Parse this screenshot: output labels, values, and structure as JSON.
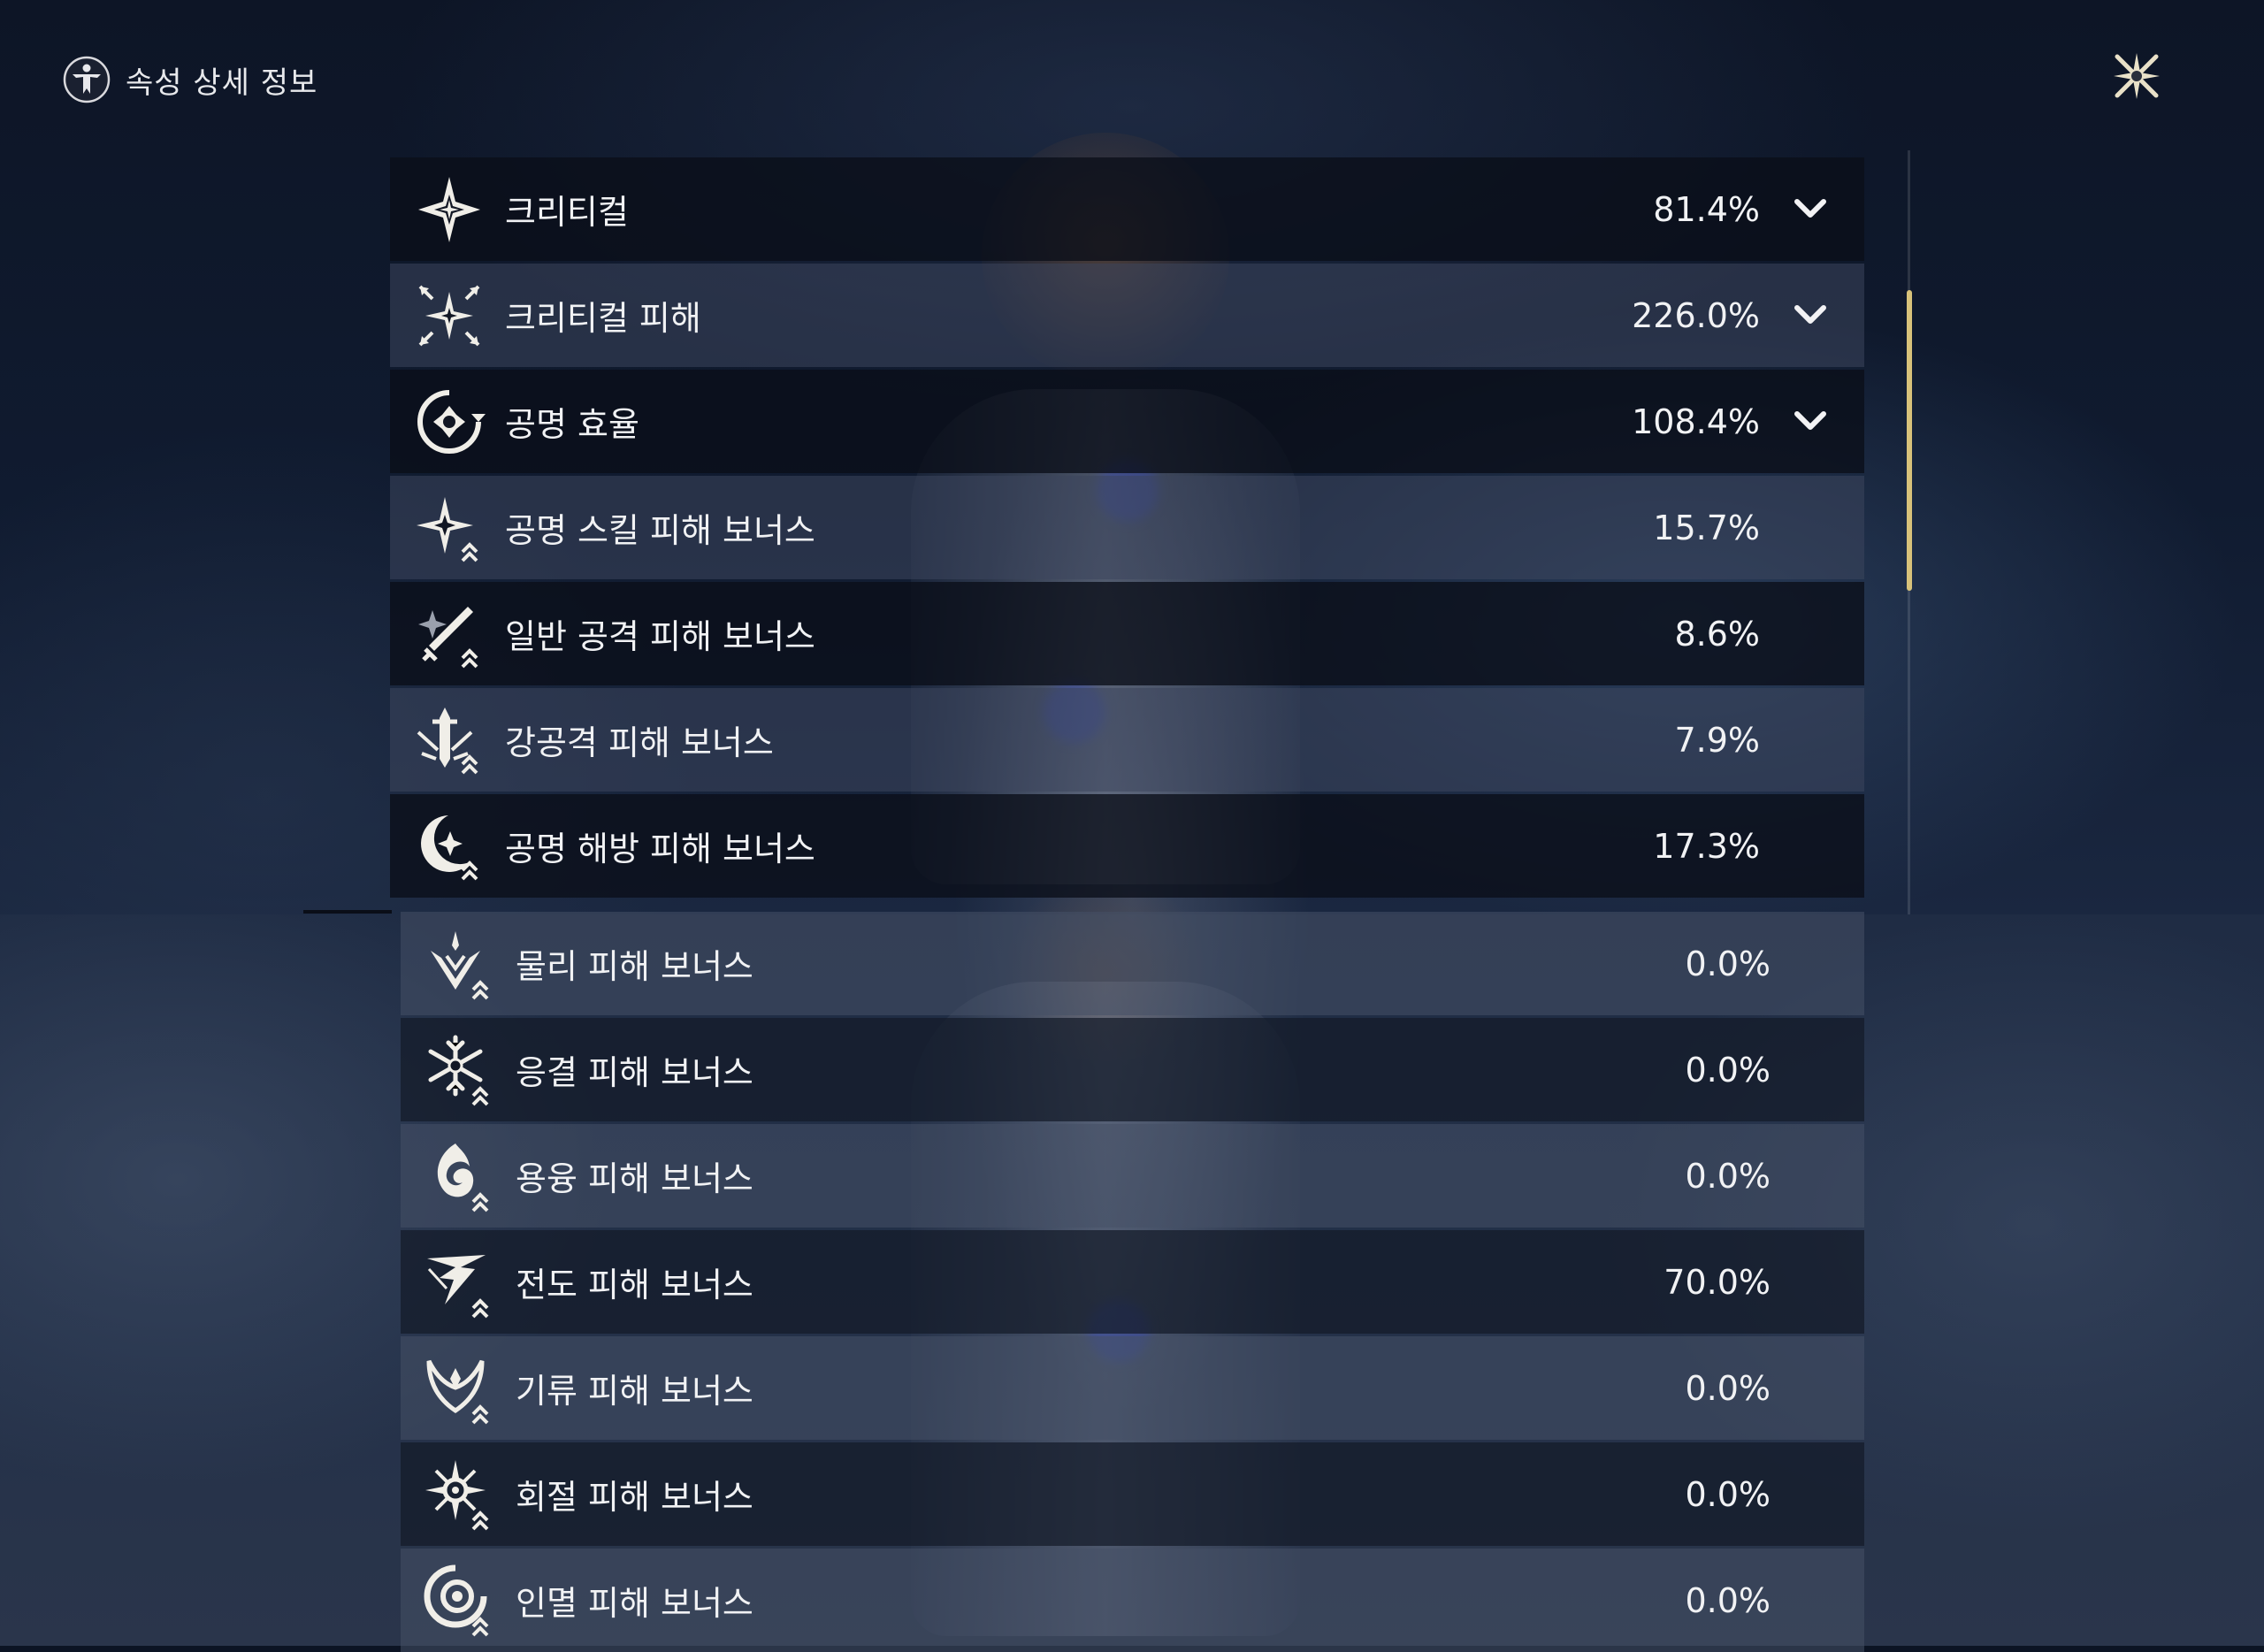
{
  "header": {
    "title": "속성 상세 정보",
    "icon": "vitruvian-figure-icon"
  },
  "close_icon": "sparkle-close-icon",
  "colors": {
    "accent": "#D8C27A",
    "text": "#ECEDEF"
  },
  "stats": [
    {
      "label": "크리티컬",
      "value": "81.4%",
      "icon": "star-burst-icon",
      "expandable": true
    },
    {
      "label": "크리티컬 피해",
      "value": "226.0%",
      "icon": "star-burst-arrows-icon",
      "expandable": true
    },
    {
      "label": "공명 효율",
      "value": "108.4%",
      "icon": "cycle-gear-icon",
      "expandable": true
    },
    {
      "label": "공명 스킬 피해 보너스",
      "value": "15.7%",
      "icon": "star-up-icon",
      "expandable": false
    },
    {
      "label": "일반 공격 피해 보너스",
      "value": "8.6%",
      "icon": "sword-up-icon",
      "expandable": false
    },
    {
      "label": "강공격 피해 보너스",
      "value": "7.9%",
      "icon": "sword-burst-up-icon",
      "expandable": false
    },
    {
      "label": "공명 해방 피해 보너스",
      "value": "17.3%",
      "icon": "moon-up-icon",
      "expandable": false
    }
  ],
  "elements": [
    {
      "label": "물리 피해 보너스",
      "value": "0.0%",
      "icon": "physical-up-icon"
    },
    {
      "label": "응결 피해 보너스",
      "value": "0.0%",
      "icon": "snowflake-up-icon"
    },
    {
      "label": "용융 피해 보너스",
      "value": "0.0%",
      "icon": "flame-swirl-up-icon"
    },
    {
      "label": "전도 피해 보너스",
      "value": "70.0%",
      "icon": "lightning-up-icon"
    },
    {
      "label": "기류 피해 보너스",
      "value": "0.0%",
      "icon": "wind-up-icon"
    },
    {
      "label": "회절 피해 보너스",
      "value": "0.0%",
      "icon": "sun-up-icon"
    },
    {
      "label": "인멸 피해 보너스",
      "value": "0.0%",
      "icon": "void-eye-up-icon"
    }
  ]
}
